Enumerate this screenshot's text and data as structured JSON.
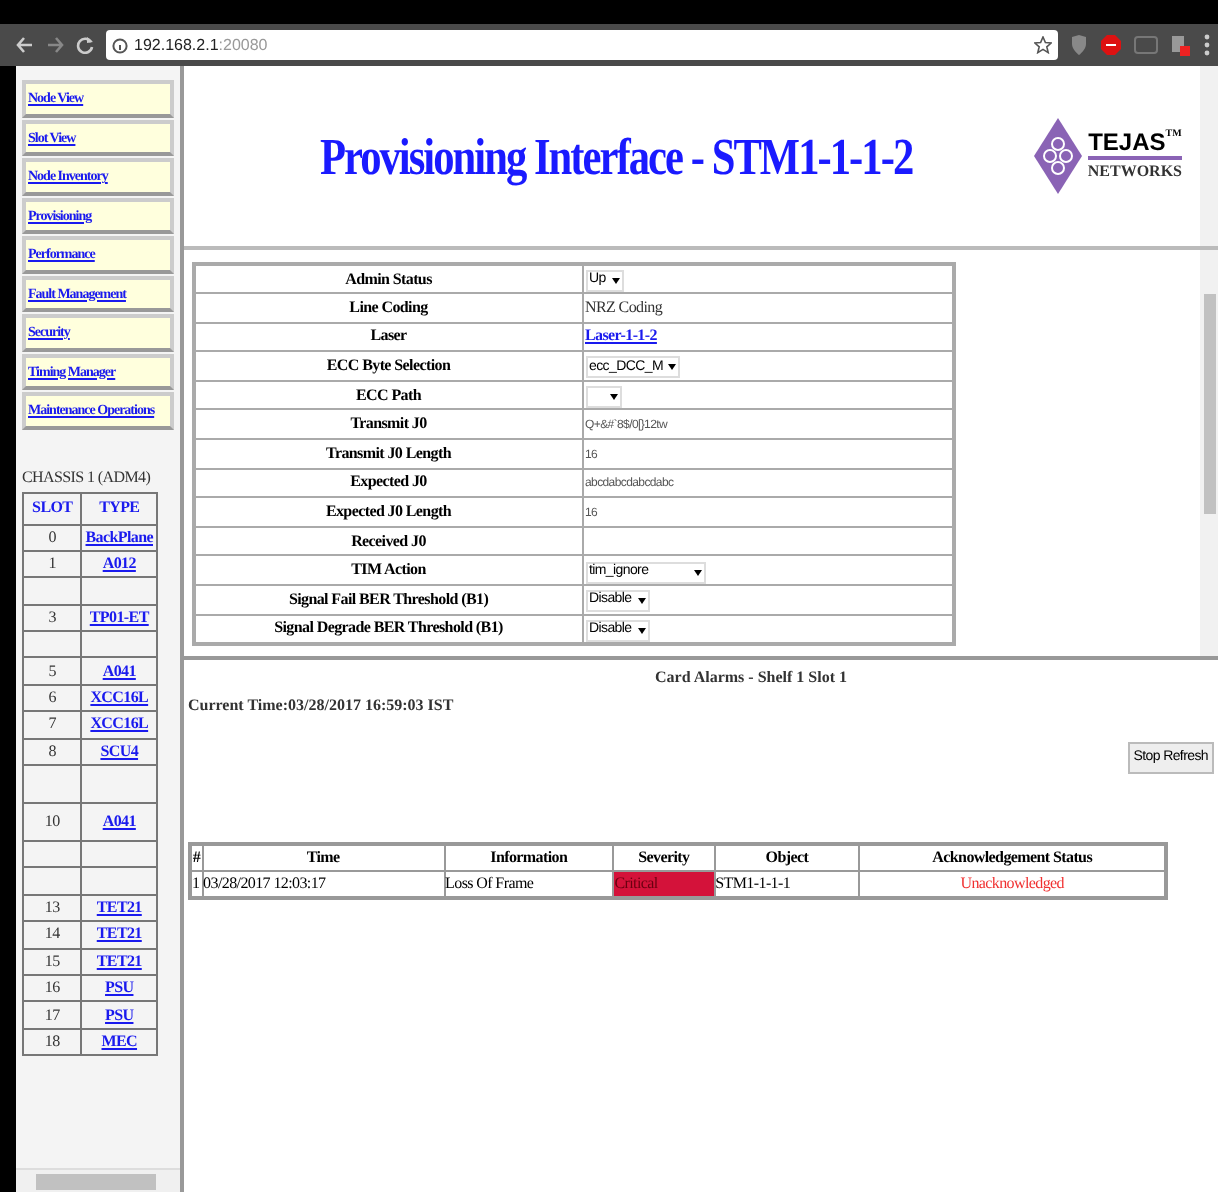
{
  "browser": {
    "url_host": "192.168.2.1",
    "url_port": ":20080"
  },
  "nav": [
    {
      "label": "Node View"
    },
    {
      "label": "Slot View"
    },
    {
      "label": "Node Inventory"
    },
    {
      "label": "Provisioning"
    },
    {
      "label": "Performance"
    },
    {
      "label": "Fault Management"
    },
    {
      "label": "Security"
    },
    {
      "label": "Timing Manager"
    },
    {
      "label": "Maintenance Operations"
    }
  ],
  "chassis": {
    "title": "CHASSIS 1 (ADM4)",
    "columns": [
      "SLOT",
      "TYPE"
    ],
    "slots": [
      {
        "kind": "card",
        "slot": "0",
        "type": "BackPlane"
      },
      {
        "kind": "card",
        "slot": "1",
        "type": "A012"
      },
      {
        "kind": "empty"
      },
      {
        "kind": "card",
        "slot": "3",
        "type": "TP01-ET"
      },
      {
        "kind": "empty"
      },
      {
        "kind": "card",
        "slot": "5",
        "type": "A041"
      },
      {
        "kind": "card",
        "slot": "6",
        "type": "XCC16L"
      },
      {
        "kind": "card",
        "slot": "7",
        "type": "XCC16L"
      },
      {
        "kind": "card",
        "slot": "8",
        "type": "SCU4"
      },
      {
        "kind": "empty",
        "tall": true
      },
      {
        "kind": "card",
        "slot": "10",
        "type": "A041",
        "tall": true
      },
      {
        "kind": "empty"
      },
      {
        "kind": "empty"
      },
      {
        "kind": "card",
        "slot": "13",
        "type": "TET21"
      },
      {
        "kind": "card",
        "slot": "14",
        "type": "TET21"
      },
      {
        "kind": "card",
        "slot": "15",
        "type": "TET21"
      },
      {
        "kind": "card",
        "slot": "16",
        "type": "PSU"
      },
      {
        "kind": "card",
        "slot": "17",
        "type": "PSU"
      },
      {
        "kind": "card",
        "slot": "18",
        "type": "MEC"
      }
    ]
  },
  "header": {
    "title": "Provisioning Interface - STM1-1-1-2",
    "logo": {
      "name": "TEJAS",
      "mark": "TM",
      "sub": "NETWORKS"
    }
  },
  "provisioning": [
    {
      "label": "Admin Status",
      "kind": "select",
      "value": "Up"
    },
    {
      "label": "Line Coding",
      "kind": "text",
      "value": "NRZ Coding"
    },
    {
      "label": "Laser",
      "kind": "link",
      "value": "Laser-1-1-2"
    },
    {
      "label": "ECC Byte Selection",
      "kind": "select",
      "value": "ecc_DCC_M"
    },
    {
      "label": "ECC Path",
      "kind": "select"
    },
    {
      "label": "Transmit J0",
      "kind": "field",
      "value": "Q+&#`8$/0[}12tw"
    },
    {
      "label": "Transmit J0 Length",
      "kind": "field",
      "value": "16"
    },
    {
      "label": "Expected J0",
      "kind": "field",
      "value": "abcdabcdabcdabc"
    },
    {
      "label": "Expected J0 Length",
      "kind": "field",
      "value": "16"
    },
    {
      "label": "Received J0",
      "kind": "text"
    },
    {
      "label": "TIM Action",
      "kind": "select",
      "value": "tim_ignore",
      "wide": true
    },
    {
      "label": "Signal Fail BER Threshold (B1)",
      "kind": "select",
      "value": "Disable"
    },
    {
      "label": "Signal Degrade BER Threshold (B1)",
      "kind": "select",
      "value": "Disable"
    }
  ],
  "alarms": {
    "title": "Card Alarms - Shelf 1 Slot 1",
    "current_time": "Current Time:03/28/2017 16:59:03 IST",
    "button": "Stop Refresh",
    "columns": [
      "#",
      "Time",
      "Information",
      "Severity",
      "Object",
      "Acknowledgement Status"
    ],
    "rows": [
      {
        "number": "1",
        "time": "03/28/2017 12:03:17",
        "information": "Loss Of Frame",
        "severity": "Critical",
        "color": "#d4123a",
        "object": "STM1-1-1-1",
        "acknowledgement": "Unacknowledged"
      }
    ]
  }
}
